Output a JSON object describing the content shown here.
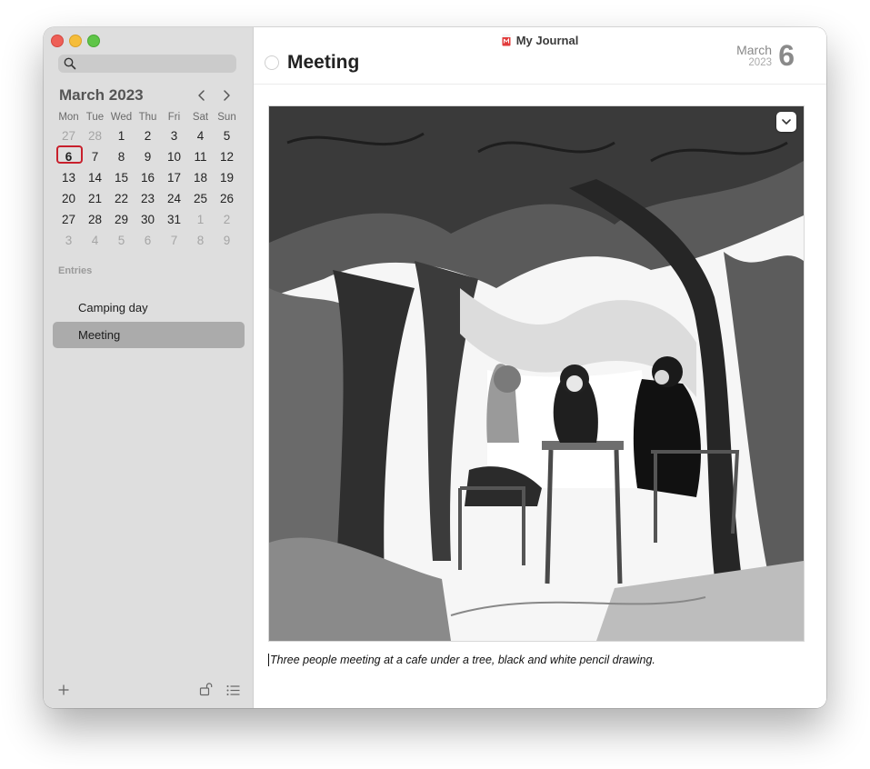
{
  "window": {
    "title": "My Journal"
  },
  "search": {
    "placeholder": ""
  },
  "calendar": {
    "month_label": "March 2023",
    "weekdays": [
      "Mon",
      "Tue",
      "Wed",
      "Thu",
      "Fri",
      "Sat",
      "Sun"
    ],
    "weeks": [
      [
        "27",
        "28",
        "1",
        "2",
        "3",
        "4",
        "5"
      ],
      [
        "6",
        "7",
        "8",
        "9",
        "10",
        "11",
        "12"
      ],
      [
        "13",
        "14",
        "15",
        "16",
        "17",
        "18",
        "19"
      ],
      [
        "20",
        "21",
        "22",
        "23",
        "24",
        "25",
        "26"
      ],
      [
        "27",
        "28",
        "29",
        "30",
        "31",
        "1",
        "2"
      ],
      [
        "3",
        "4",
        "5",
        "6",
        "7",
        "8",
        "9"
      ]
    ],
    "selected_day": "6",
    "accent_color": "#c8202c"
  },
  "sidebar": {
    "entries_label": "Entries",
    "entries": [
      {
        "title": "Camping day"
      },
      {
        "title": "Meeting"
      }
    ],
    "icons": [
      "plus-icon",
      "unlock-icon",
      "list-icon"
    ]
  },
  "entry": {
    "title": "Meeting",
    "date_month": "March",
    "date_year": "2023",
    "date_day": "6",
    "caption": "Three people meeting at a cafe under a tree, black and white pencil drawing."
  }
}
